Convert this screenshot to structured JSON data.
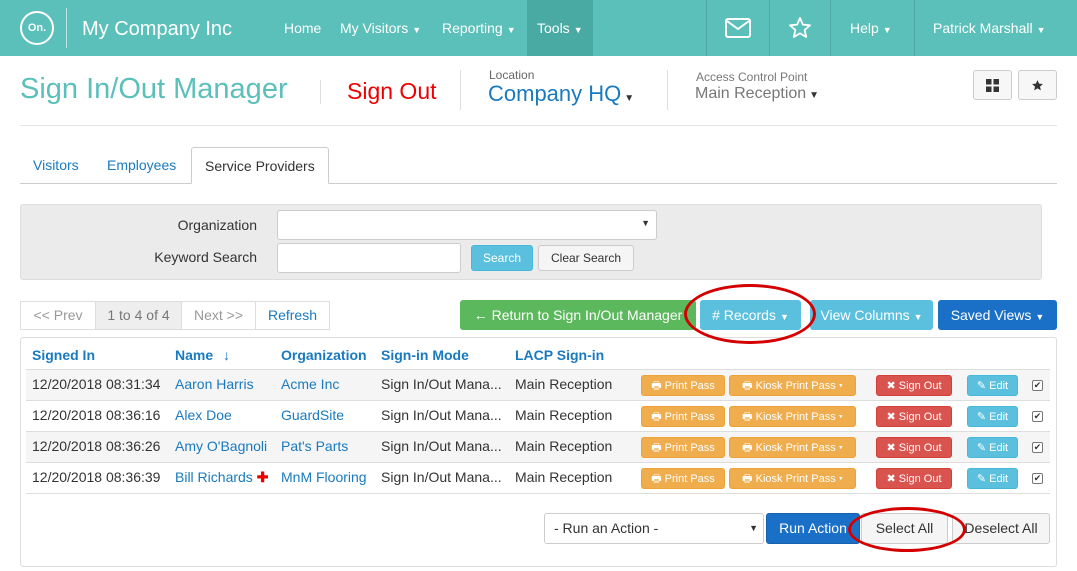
{
  "nav": {
    "logo": "On.",
    "brand": "My Company Inc",
    "items": [
      {
        "label": "Home",
        "has_caret": false
      },
      {
        "label": "My Visitors",
        "has_caret": true
      },
      {
        "label": "Reporting",
        "has_caret": true
      },
      {
        "label": "Tools",
        "has_caret": true
      }
    ],
    "mail_icon": "envelope-icon",
    "star_icon": "star-icon",
    "help": "Help",
    "user": "Patrick Marshall"
  },
  "header": {
    "title": "Sign In/Out Manager",
    "sign_out": "Sign Out",
    "location_label": "Location",
    "location_value": "Company HQ",
    "acp_label": "Access Control Point",
    "acp_value": "Main Reception"
  },
  "tabs": [
    "Visitors",
    "Employees",
    "Service Providers"
  ],
  "filter": {
    "organization_label": "Organization",
    "organization_value": "",
    "keyword_label": "Keyword Search",
    "keyword_value": "",
    "search": "Search",
    "clear": "Clear Search"
  },
  "pager": {
    "prev": "<< Prev",
    "range": "1 to 4 of 4",
    "next": "Next >>",
    "refresh": "Refresh"
  },
  "actions": {
    "return": "Return to Sign In/Out Manager",
    "records": "# Records",
    "view_columns": "View Columns",
    "saved_views": "Saved Views"
  },
  "table": {
    "columns": [
      "Signed In",
      "Name",
      "Organization",
      "Sign-in Mode",
      "LACP Sign-in"
    ],
    "sort_indicator": "↓",
    "row_buttons": {
      "print": "Print Pass",
      "kiosk": "Kiosk Print Pass",
      "sign_out": "Sign Out",
      "edit": "Edit"
    },
    "rows": [
      {
        "signed_in": "12/20/2018 08:31:34",
        "name": "Aaron Harris",
        "organization": "Acme Inc",
        "mode": "Sign In/Out Mana...",
        "lacp": "Main Reception",
        "flag": "",
        "checked": true
      },
      {
        "signed_in": "12/20/2018 08:36:16",
        "name": "Alex Doe",
        "organization": "GuardSite",
        "mode": "Sign In/Out Mana...",
        "lacp": "Main Reception",
        "flag": "",
        "checked": true
      },
      {
        "signed_in": "12/20/2018 08:36:26",
        "name": "Amy O'Bagnoli",
        "organization": "Pat's Parts",
        "mode": "Sign In/Out Mana...",
        "lacp": "Main Reception",
        "flag": "",
        "checked": true
      },
      {
        "signed_in": "12/20/2018 08:36:39",
        "name": "Bill Richards",
        "organization": "MnM Flooring",
        "mode": "Sign In/Out Mana...",
        "lacp": "Main Reception",
        "flag": "✚",
        "checked": true
      }
    ]
  },
  "bottom": {
    "action_placeholder": "- Run an Action -",
    "run": "Run Action",
    "select_all": "Select All",
    "deselect_all": "Deselect All"
  },
  "colors": {
    "brand": "#5bc0b9",
    "link": "#1a7abf",
    "annotation": "#d40000"
  }
}
